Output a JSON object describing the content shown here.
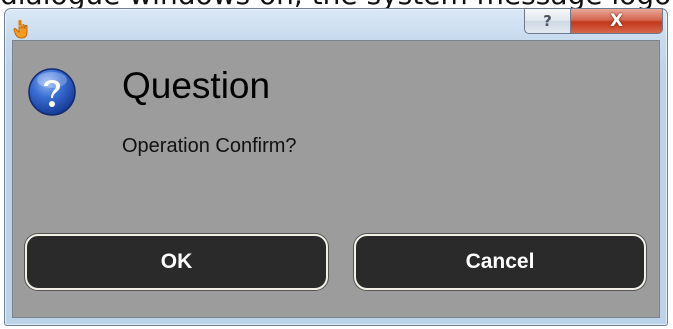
{
  "background_text": "dialogue windows on, the system message logo",
  "window": {
    "app_icon": "hand-pointer-icon",
    "help_button_label": "?",
    "close_button_label": "X"
  },
  "dialog": {
    "icon": "question-icon",
    "title": "Question",
    "message": "Operation Confirm?",
    "ok_label": "OK",
    "cancel_label": "Cancel"
  },
  "colors": {
    "content_background": "#9c9c9c",
    "button_background": "#2a2a2a",
    "button_border": "#f2f0e6",
    "close_button": "#c3381d",
    "question_icon": "#1f4fb8"
  }
}
